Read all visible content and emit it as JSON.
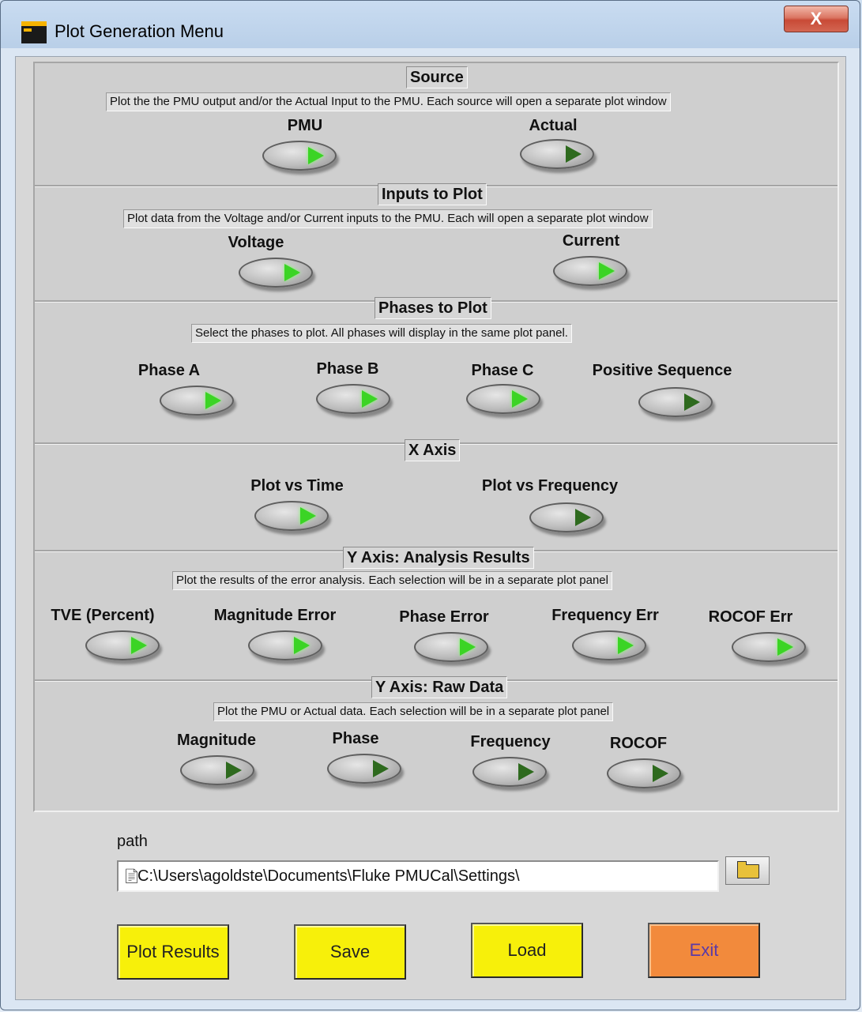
{
  "window": {
    "title": "Plot Generation Menu",
    "close_label": "X"
  },
  "source": {
    "title": "Source",
    "desc": "Plot the the PMU output and/or the Actual Input to the PMU.  Each source will open a separate plot window",
    "pmu": "PMU",
    "actual": "Actual"
  },
  "inputs": {
    "title": "Inputs to Plot",
    "desc": "Plot data from the Voltage and/or Current inputs to the PMU. Each will open a separate plot window",
    "voltage": "Voltage",
    "current": "Current"
  },
  "phases": {
    "title": "Phases to Plot",
    "desc": "Select the phases to plot.  All phases will display in the same plot panel.",
    "a": "Phase A",
    "b": "Phase B",
    "c": "Phase C",
    "pos": "Positive Sequence"
  },
  "xaxis": {
    "title": "X Axis",
    "time": "Plot vs Time",
    "freq": "Plot vs Frequency"
  },
  "yanalysis": {
    "title": "Y Axis: Analysis Results",
    "desc": "Plot the results of the  error analysis.  Each selection will be in a separate plot panel",
    "tve": "TVE (Percent)",
    "mag": "Magnitude Error",
    "phase": "Phase Error",
    "freq": "Frequency Err",
    "rocof": "ROCOF Err"
  },
  "yraw": {
    "title": "Y Axis: Raw Data",
    "desc": "Plot the PMU or Actual data.  Each selection will be in a separate plot panel",
    "mag": "Magnitude",
    "phase": "Phase",
    "freq": "Frequency",
    "rocof": "ROCOF"
  },
  "path": {
    "label": "path",
    "value": "C:\\Users\\agoldste\\Documents\\Fluke PMUCal\\Settings\\"
  },
  "buttons": {
    "plot": "Plot Results",
    "save": "Save",
    "load": "Load",
    "exit": "Exit"
  },
  "toggles": {
    "pmu": true,
    "actual": false,
    "voltage": true,
    "current": true,
    "phase_a": true,
    "phase_b": true,
    "phase_c": true,
    "positive_sequence": false,
    "plot_vs_time": true,
    "plot_vs_frequency": false,
    "tve": true,
    "magnitude_error": true,
    "phase_error": true,
    "frequency_err": true,
    "rocof_err": true,
    "raw_magnitude": false,
    "raw_phase": false,
    "raw_frequency": false,
    "raw_rocof": false
  },
  "colors": {
    "led_on": "#3bd425",
    "led_off": "#2e6a1e",
    "button_yellow": "#f7f00a",
    "button_orange": "#f28a3c"
  }
}
